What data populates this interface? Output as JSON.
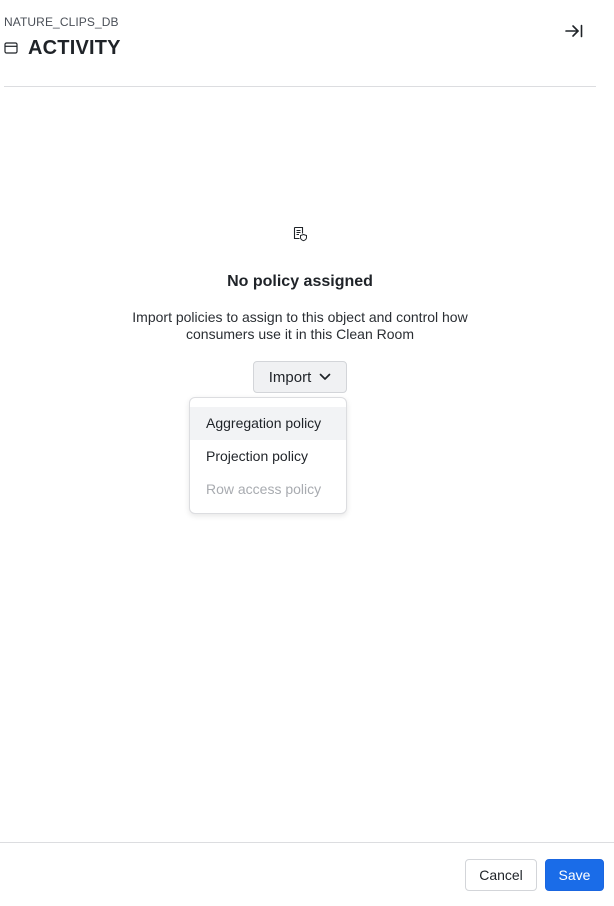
{
  "header": {
    "breadcrumb": "NATURE_CLIPS_DB",
    "title": "ACTIVITY",
    "title_icon": "table-icon",
    "collapse_icon": "collapse-panel-icon"
  },
  "empty_state": {
    "icon": "policy-document-icon",
    "title": "No policy assigned",
    "description": "Import policies to assign to this object and control how consumers use it in this Clean Room"
  },
  "import_menu": {
    "button_label": "Import",
    "button_icon": "chevron-down-icon",
    "items": [
      {
        "label": "Aggregation policy",
        "state": "hovered"
      },
      {
        "label": "Projection policy",
        "state": "enabled"
      },
      {
        "label": "Row access policy",
        "state": "disabled"
      }
    ]
  },
  "footer": {
    "cancel_label": "Cancel",
    "save_label": "Save"
  },
  "colors": {
    "primary": "#1a6ce8",
    "disabled_text": "#a8abb0",
    "divider": "#dcdde0"
  }
}
